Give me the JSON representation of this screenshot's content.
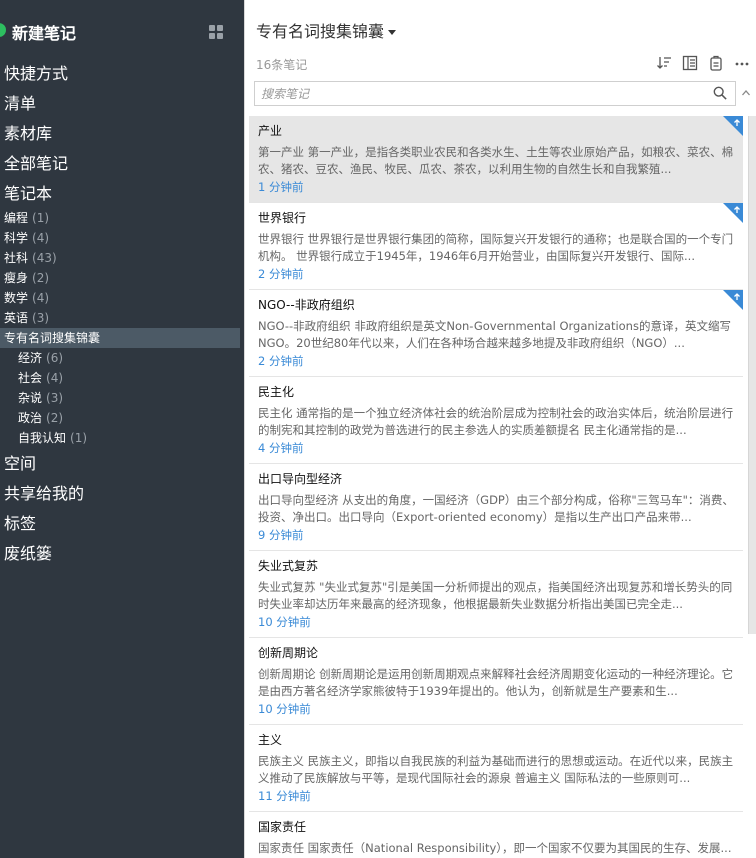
{
  "sidebar": {
    "new_note_label": "新建笔记",
    "nav_top": [
      "快捷方式",
      "清单",
      "素材库",
      "全部笔记",
      "笔记本"
    ],
    "notebooks": [
      {
        "label": "编程",
        "count": "(1)"
      },
      {
        "label": "科学",
        "count": "(4)"
      },
      {
        "label": "社科",
        "count": "(43)"
      },
      {
        "label": "瘦身",
        "count": "(2)"
      },
      {
        "label": "数学",
        "count": "(4)"
      },
      {
        "label": "英语",
        "count": "(3)"
      }
    ],
    "selected_notebook": {
      "label": "专有名词搜集锦囊"
    },
    "sub_notebooks": [
      {
        "label": "经济",
        "count": "(6)"
      },
      {
        "label": "社会",
        "count": "(4)"
      },
      {
        "label": "杂说",
        "count": "(3)"
      },
      {
        "label": "政治",
        "count": "(2)"
      },
      {
        "label": "自我认知",
        "count": "(1)"
      }
    ],
    "nav_bottom": [
      "空间",
      "共享给我的",
      "标签",
      "废纸篓"
    ]
  },
  "main": {
    "title": "专有名词搜集锦囊",
    "note_count": "16条笔记",
    "search_placeholder": "搜索笔记"
  },
  "notes": [
    {
      "title": "产业",
      "snippet": "第一产业 第一产业，是指各类职业农民和各类水生、土生等农业原始产品，如粮农、菜农、棉农、猪农、豆农、渔民、牧民、瓜农、茶农，以利用生物的自然生长和自我繁殖...",
      "time": "1 分钟前",
      "pinned": true,
      "selected": true
    },
    {
      "title": "世界银行",
      "snippet": "世界银行 世界银行是世界银行集团的简称，国际复兴开发银行的通称；也是联合国的一个专门机构。 世界银行成立于1945年，1946年6月开始营业，由国际复兴开发银行、国际...",
      "time": "2 分钟前",
      "pinned": true,
      "selected": false
    },
    {
      "title": "NGO--非政府组织",
      "snippet": "NGO--非政府组织 非政府组织是英文Non-Governmental Organizations的意译，英文缩写NGO。20世纪80年代以来，人们在各种场合越来越多地提及非政府组织（NGO）...",
      "time": "2 分钟前",
      "pinned": true,
      "selected": false
    },
    {
      "title": "民主化",
      "snippet": "民主化 通常指的是一个独立经济体社会的统治阶层成为控制社会的政治实体后，统治阶层进行的制宪和其控制的政党为普选进行的民主参选人的实质差额提名 民主化通常指的是...",
      "time": "4 分钟前",
      "pinned": false,
      "selected": false
    },
    {
      "title": "出口导向型经济",
      "snippet": "出口导向型经济 从支出的角度，一国经济（GDP）由三个部分构成，俗称\"三驾马车\"：消费、投资、净出口。出口导向（Export-oriented economy）是指以生产出口产品来带...",
      "time": "9 分钟前",
      "pinned": false,
      "selected": false
    },
    {
      "title": "失业式复苏",
      "snippet": "失业式复苏 \"失业式复苏\"引是美国一分析师提出的观点，指美国经济出现复苏和增长势头的同时失业率却达历年来最高的经济现象，他根据最新失业数据分析指出美国已完全走...",
      "time": "10 分钟前",
      "pinned": false,
      "selected": false
    },
    {
      "title": "创新周期论",
      "snippet": "创新周期论 创新周期论是运用创新周期观点来解释社会经济周期变化运动的一种经济理论。它是由西方著名经济学家熊彼特于1939年提出的。他认为，创新就是生产要素和生...",
      "time": "10 分钟前",
      "pinned": false,
      "selected": false
    },
    {
      "title": "主义",
      "snippet": "民族主义 民族主义，即指以自我民族的利益为基础而进行的思想或运动。在近代以来，民族主义推动了民族解放与平等，是现代国际社会的源泉 普遍主义 国际私法的一些原则可...",
      "time": "11 分钟前",
      "pinned": false,
      "selected": false
    },
    {
      "title": "国家责任",
      "snippet": "国家责任 国家责任（National Responsibility），即一个国家不仅要为其国民的生存、发展...",
      "time": "",
      "pinned": false,
      "selected": false
    }
  ]
}
